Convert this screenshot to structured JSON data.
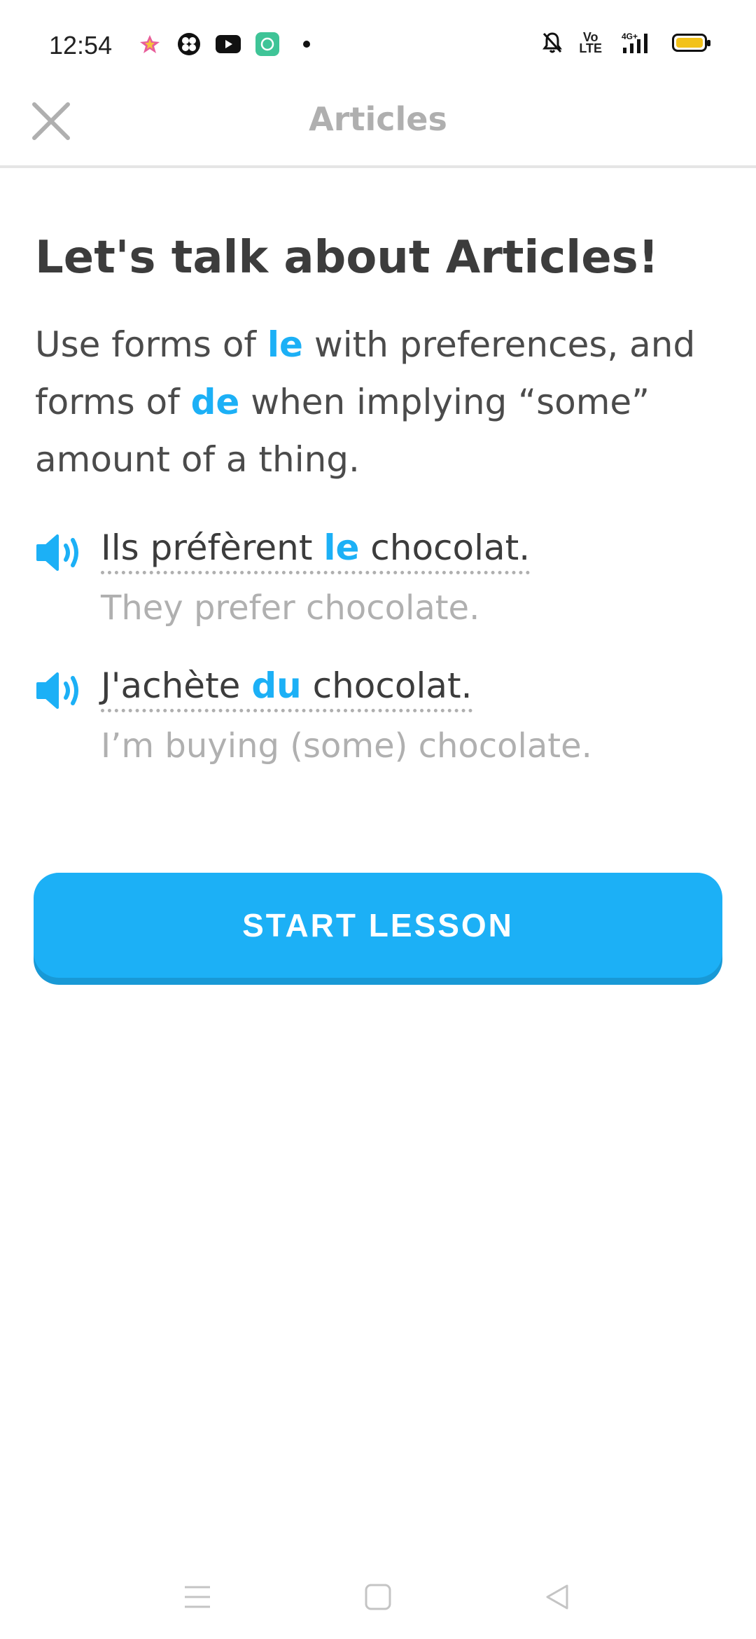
{
  "status_bar": {
    "time": "12:54",
    "network_volte": "Vo\nLTE",
    "network_type": "4G+"
  },
  "header": {
    "title": "Articles"
  },
  "main": {
    "title": "Let's talk about Articles!",
    "description": {
      "part1": "Use forms of ",
      "hl1": "le",
      "part2": " with preferences, and forms of ",
      "hl2": "de",
      "part3": " when implying “some” amount of a thing."
    },
    "examples": [
      {
        "fr_before": "Ils préfèrent ",
        "fr_hl": "le",
        "fr_after": " chocolat.",
        "en": "They prefer chocolate."
      },
      {
        "fr_before": "J'achète ",
        "fr_hl": "du",
        "fr_after": " chocolat.",
        "en": "I’m buying (some) chocolate."
      }
    ],
    "start_button": "START LESSON"
  },
  "colors": {
    "accent": "#1cb0f6",
    "accent_shadow": "#1899d6",
    "title_gray": "#afafaf",
    "text": "#4b4b4b"
  },
  "icons": {
    "close": "close-icon",
    "speaker": "speaker-icon",
    "nav_menu": "menu-icon",
    "nav_home": "home-icon",
    "nav_back": "back-icon"
  }
}
